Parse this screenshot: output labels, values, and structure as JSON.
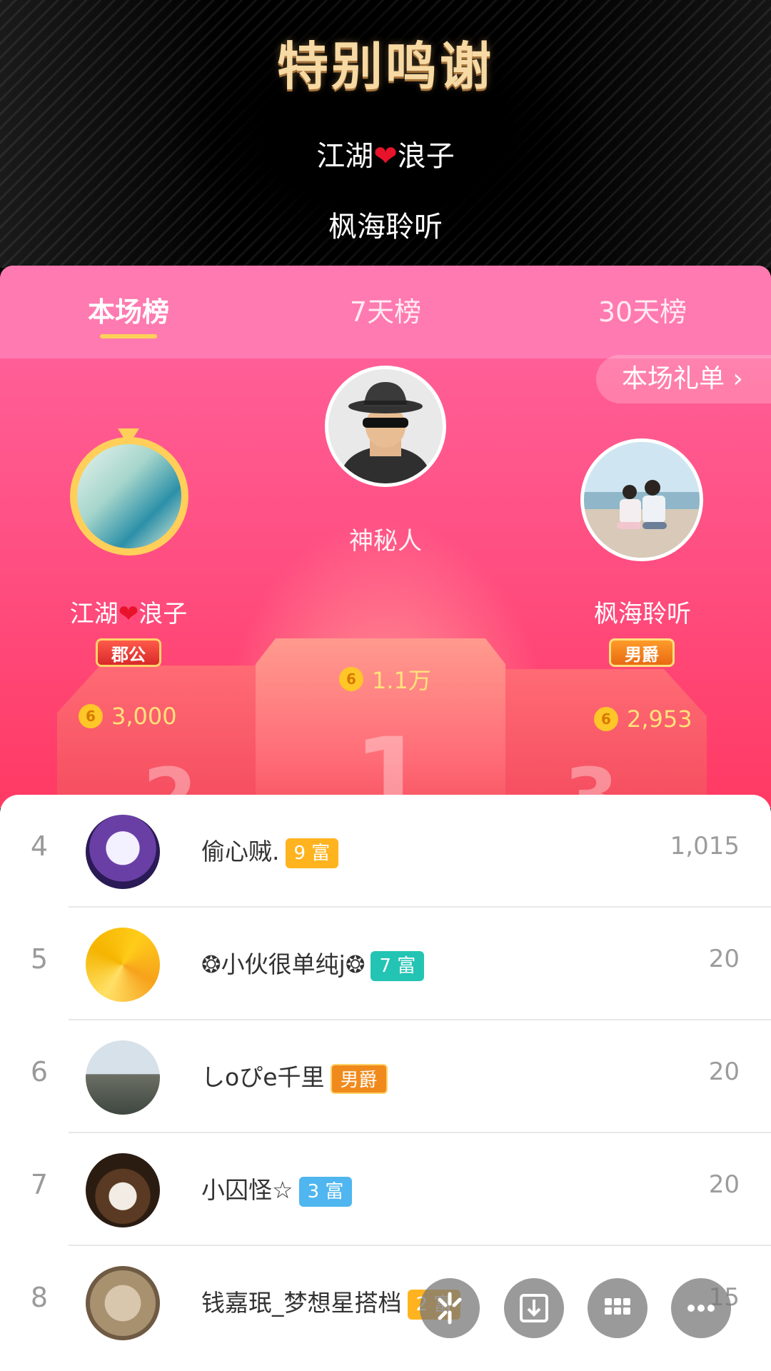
{
  "header": {
    "title": "特别鸣谢",
    "thanks": [
      "江湖",
      "浪子",
      "枫海聆听"
    ]
  },
  "tabs": [
    {
      "label": "本场榜",
      "active": true
    },
    {
      "label": "7天榜",
      "active": false
    },
    {
      "label": "30天榜",
      "active": false
    }
  ],
  "gift_list_button": "本场礼单 ›",
  "podium": {
    "first": {
      "rank": "1",
      "name": "神秘人",
      "score": "1.1万"
    },
    "second": {
      "rank": "2",
      "name_a": "江湖",
      "name_b": "浪子",
      "title": "郡公",
      "score": "3,000"
    },
    "third": {
      "rank": "3",
      "name": "枫海聆听",
      "title": "男爵",
      "score": "2,953"
    }
  },
  "coin_glyph": "6",
  "list": [
    {
      "rank": "4",
      "name": "偷心贼.",
      "badge": "9 富",
      "badge_color": "#ffb31f",
      "score": "1,015"
    },
    {
      "rank": "5",
      "name": "❂小伙很单纯j❂",
      "badge": "7 富",
      "badge_color": "#23c4b3",
      "score": "20"
    },
    {
      "rank": "6",
      "name": "しoぴe千里",
      "badge": "男爵",
      "badge_color": "#f08a1c",
      "score": "20"
    },
    {
      "rank": "7",
      "name": "小囚怪☆",
      "badge": "3 富",
      "badge_color": "#4fb6ef",
      "score": "20"
    },
    {
      "rank": "8",
      "name": "钱嘉珉_梦想星搭档",
      "badge": "2 富",
      "badge_color": "#ffb31f",
      "score": "15"
    }
  ],
  "colors": {
    "accent": "#ffd257",
    "panel_pink": "#ff5e96",
    "gold_text": "#f7d9a3"
  }
}
